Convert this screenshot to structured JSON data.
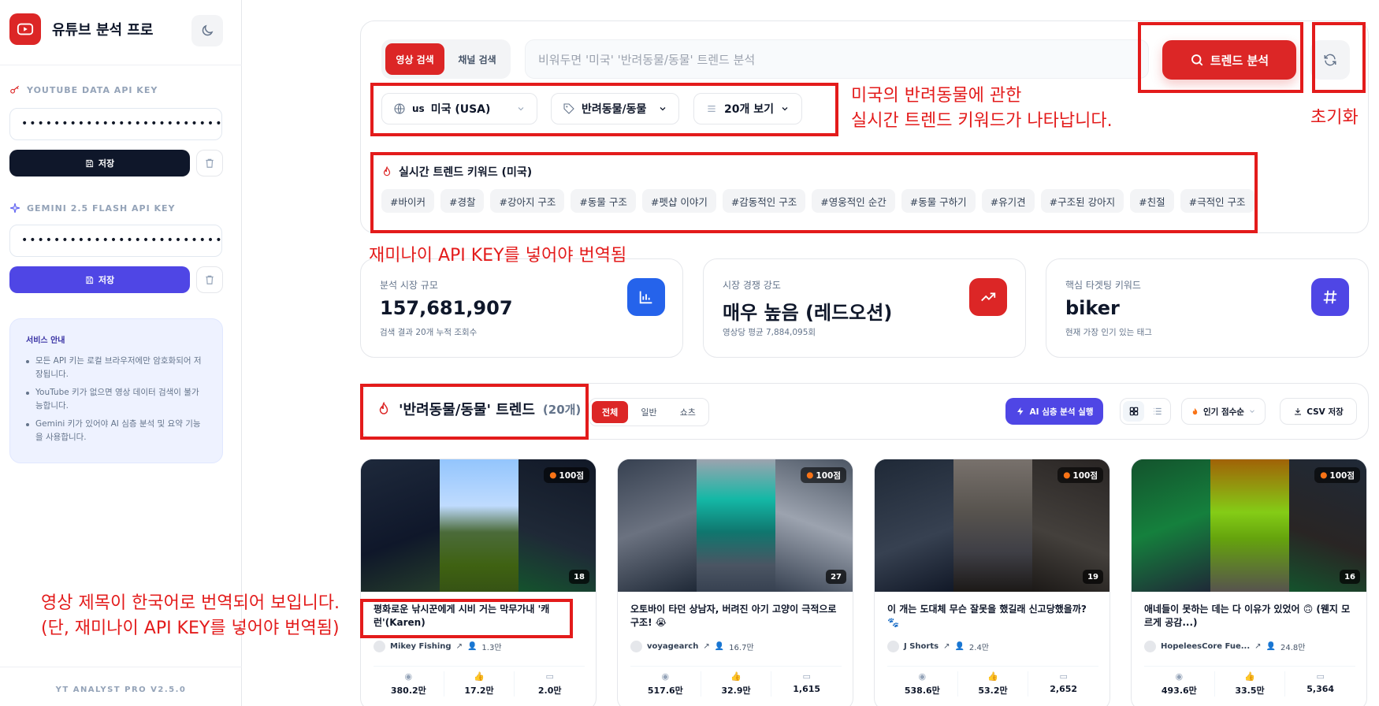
{
  "app": {
    "title": "유튜브 분석 프로",
    "version": "YT ANALYST PRO V2.5.0"
  },
  "sidebar": {
    "youtube_key": {
      "label": "YOUTUBE DATA API KEY",
      "value": "••••••••••••••••••••••••••••••••••••••",
      "save_label": "저장"
    },
    "gemini_key": {
      "label": "GEMINI 2.5 FLASH API KEY",
      "value": "••••••••••••••••••••••••••••••••••••••",
      "save_label": "저장"
    },
    "info": {
      "title": "서비스 안내",
      "items": [
        "모든 API 키는 로컬 브라우저에만 암호화되어 저장됩니다.",
        "YouTube 키가 없으면 영상 데이터 검색이 불가능합니다.",
        "Gemini 키가 있어야 AI 심층 분석 및 요약 기능을 사용합니다."
      ]
    }
  },
  "search": {
    "tabs": [
      "영상 검색",
      "채널 검색"
    ],
    "placeholder": "비워두면 '미국' '반려동물/동물' 트렌드 분석",
    "trend_button": "트렌드 분석",
    "region": {
      "code": "us",
      "label": "미국 (USA)"
    },
    "category": "반려동물/동물",
    "page_size": "20개 보기"
  },
  "keywords": {
    "title": "실시간 트렌드 키워드 (미국)",
    "items": [
      "#바이커",
      "#경찰",
      "#강아지 구조",
      "#동물 구조",
      "#펫샵 이야기",
      "#감동적인 구조",
      "#영웅적인 순간",
      "#동물 구하기",
      "#유기견",
      "#구조된 강아지",
      "#친절",
      "#극적인 구조"
    ]
  },
  "annotations": {
    "filters_note_1": "미국의 반려동물에 관한",
    "filters_note_2": "실시간 트렌드 키워드가 나타납니다.",
    "reset_note": "초기화",
    "gemini_note": "재미나이 API KEY를 넣어야 번역됨",
    "title_note_1": "영상 제목이 한국어로 번역되어 보입니다.",
    "title_note_2": "(단, 재미나이 API KEY를 넣어야 번역됨)"
  },
  "stats": [
    {
      "label": "분석 시장 규모",
      "value": "157,681,907",
      "sub": "검색 결과 20개 누적 조회수",
      "color": "#2563eb",
      "icon": "bar-chart-icon"
    },
    {
      "label": "시장 경쟁 강도",
      "value": "매우 높음 (레드오션)",
      "sub": "영상당 평균 7,884,095회",
      "color": "#dc2626",
      "icon": "trending-up-icon"
    },
    {
      "label": "핵심 타겟팅 키워드",
      "value": "biker",
      "sub": "현재 가장 인기 있는 태그",
      "color": "#4f46e5",
      "icon": "hash-icon"
    }
  ],
  "results": {
    "title": "'반려동물/동물' 트렌드",
    "count": "(20개)",
    "filters": [
      "전체",
      "일반",
      "쇼츠"
    ],
    "ai_button": "AI 심층 분석 실행",
    "sort": "인기 점수순",
    "csv": "CSV 저장"
  },
  "videos": [
    {
      "score": "100점",
      "duration": "18",
      "title": "평화로운 낚시꾼에게 시비 거는 막무가내 '캐런'(Karen)",
      "channel": "Mikey Fishing",
      "subs": "1.3만",
      "views": "380.2만",
      "likes": "17.2만",
      "comments": "2.0만"
    },
    {
      "score": "100점",
      "duration": "27",
      "title": "오토바이 타던 상남자, 버려진 아기 고양이 극적으로 구조! 😭",
      "channel": "voyagearch",
      "subs": "16.7만",
      "views": "517.6만",
      "likes": "32.9만",
      "comments": "1,615"
    },
    {
      "score": "100점",
      "duration": "19",
      "title": "이 개는 도대체 무슨 잘못을 했길래 신고당했을까? 🐾",
      "channel": "J Shorts",
      "subs": "2.4만",
      "views": "538.6만",
      "likes": "53.2만",
      "comments": "2,652"
    },
    {
      "score": "100점",
      "duration": "16",
      "title": "애네들이 못하는 데는 다 이유가 있었어 🙃 (웬지 모르게 공감...)",
      "channel": "HopeleesCore Fue...",
      "subs": "24.8만",
      "views": "493.6만",
      "likes": "33.5만",
      "comments": "5,364"
    }
  ],
  "colors": {
    "accent": "#dc2626",
    "purple": "#4f46e5",
    "annotation": "#e31b1b"
  }
}
